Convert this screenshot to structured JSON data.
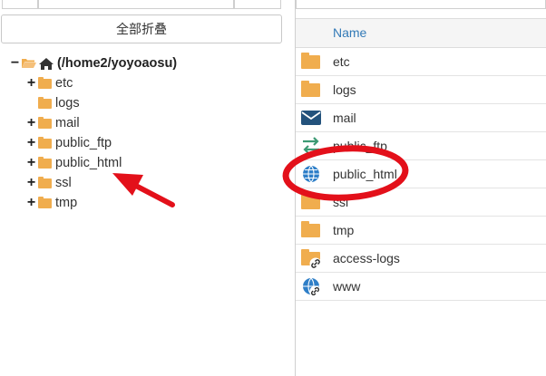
{
  "left_pane": {
    "collapse_all_label": "全部折叠",
    "root_label": "(/home2/yoyoaosu)",
    "tree_items": [
      {
        "label": "etc",
        "expandable": true
      },
      {
        "label": "logs",
        "expandable": false
      },
      {
        "label": "mail",
        "expandable": true
      },
      {
        "label": "public_ftp",
        "expandable": true
      },
      {
        "label": "public_html",
        "expandable": true
      },
      {
        "label": "ssl",
        "expandable": true
      },
      {
        "label": "tmp",
        "expandable": true
      }
    ]
  },
  "right_pane": {
    "column_name_label": "Name",
    "files": [
      {
        "name": "etc",
        "icon": "folder-icon"
      },
      {
        "name": "logs",
        "icon": "folder-icon"
      },
      {
        "name": "mail",
        "icon": "envelope-icon"
      },
      {
        "name": "public_ftp",
        "icon": "transfer-arrows-icon"
      },
      {
        "name": "public_html",
        "icon": "globe-icon"
      },
      {
        "name": "ssl",
        "icon": "folder-icon"
      },
      {
        "name": "tmp",
        "icon": "folder-icon"
      },
      {
        "name": "access-logs",
        "icon": "folder-link-icon"
      },
      {
        "name": "www",
        "icon": "globe-link-icon"
      }
    ]
  },
  "colors": {
    "folder": "#f0ad4e",
    "link_blue": "#337ab7",
    "annotation_red": "#e3101a"
  }
}
